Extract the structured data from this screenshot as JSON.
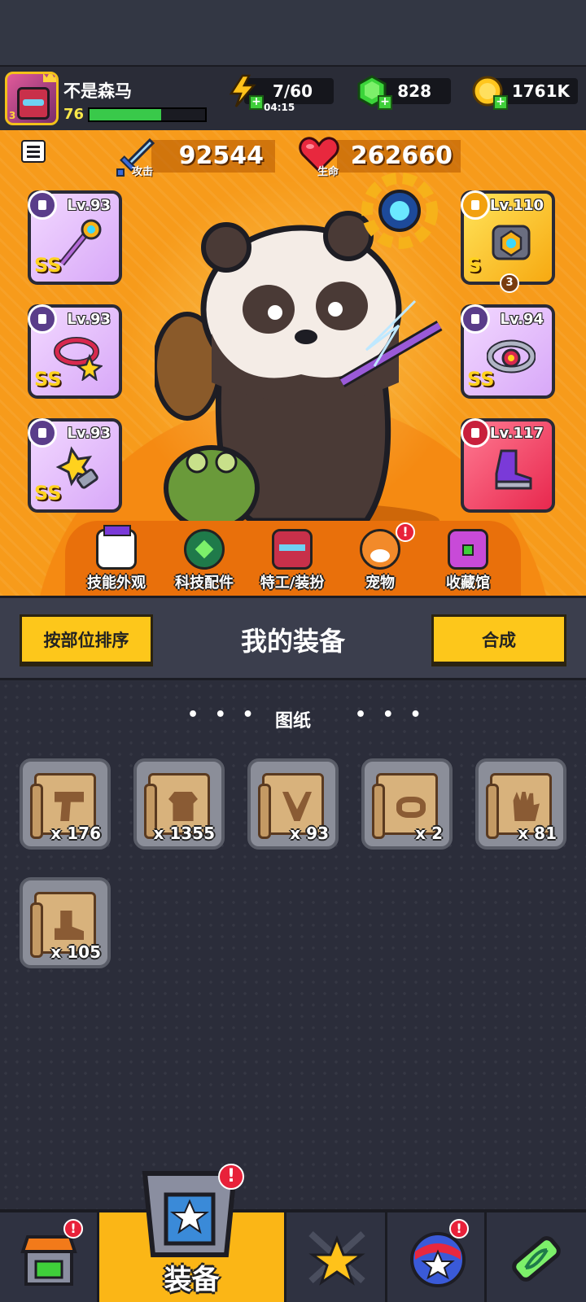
{
  "player": {
    "name": "不是森马",
    "level": "76",
    "xp_fraction": 0.62,
    "avatar_rank": "3"
  },
  "resources": {
    "energy": "7/60",
    "energy_timer": "04:15",
    "gems": "828",
    "coins": "1761K"
  },
  "stats": {
    "attack_value": "92544",
    "attack_label": "攻击",
    "hp_value": "262660",
    "hp_label": "生命"
  },
  "equipment_slots": {
    "weapon": {
      "level": "Lv.93",
      "grade": "SS"
    },
    "necklace": {
      "level": "Lv.93",
      "grade": "SS"
    },
    "gloves": {
      "level": "Lv.93",
      "grade": "SS"
    },
    "armor": {
      "level": "Lv.110",
      "grade": "S",
      "stars": "3"
    },
    "belt": {
      "level": "Lv.94",
      "grade": "SS"
    },
    "boots": {
      "level": "Lv.117"
    }
  },
  "features": [
    {
      "label": "技能外观"
    },
    {
      "label": "科技配件"
    },
    {
      "label": "特工/装扮"
    },
    {
      "label": "宠物"
    },
    {
      "label": "收藏馆"
    }
  ],
  "equip_header": {
    "sort_button": "按部位排序",
    "title": "我的装备",
    "merge_button": "合成"
  },
  "blueprints": {
    "section_title": "图纸",
    "dots": "• • •",
    "items": [
      {
        "type": "weapon",
        "count": "x 176"
      },
      {
        "type": "armor",
        "count": "x 1355"
      },
      {
        "type": "necklace",
        "count": "x 93"
      },
      {
        "type": "belt",
        "count": "x 2"
      },
      {
        "type": "gloves",
        "count": "x 81"
      },
      {
        "type": "boots",
        "count": "x 105"
      }
    ]
  },
  "bottom_nav": {
    "active_label": "装备",
    "alert": "!"
  },
  "colors": {
    "accent_yellow": "#fdc71b",
    "hero_orange": "#f79b1b",
    "alert_red": "#e8213a",
    "xp_green": "#39c94a"
  }
}
